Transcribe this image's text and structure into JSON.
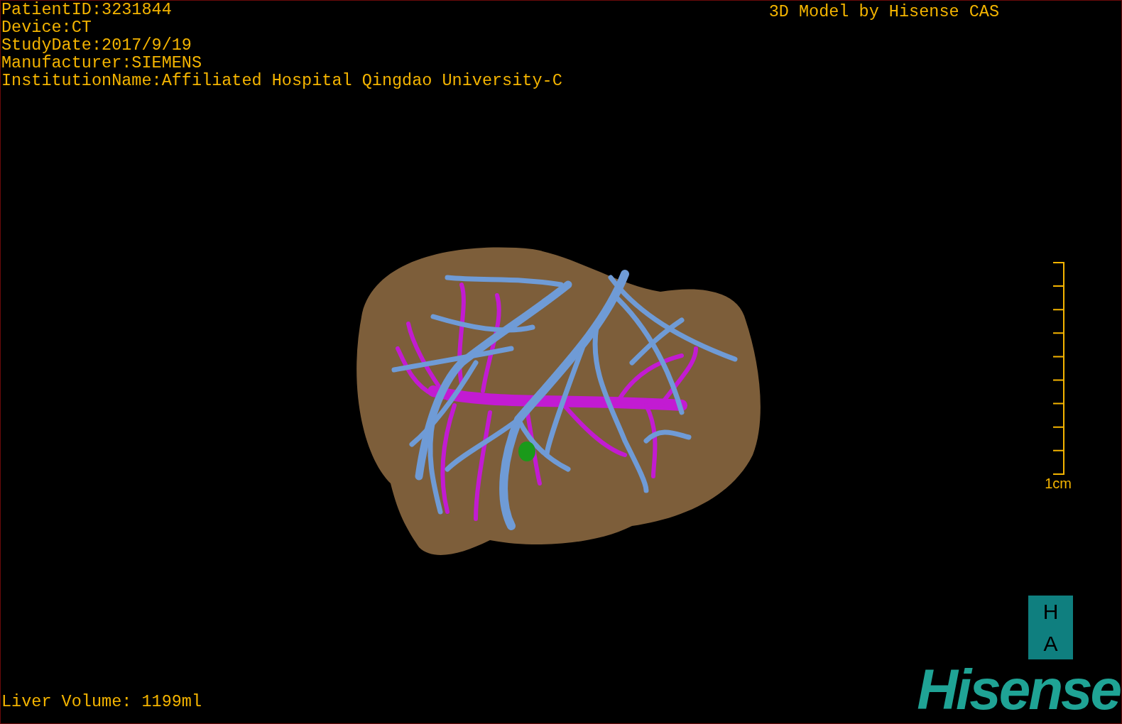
{
  "info_lines": [
    "PatientID:3231844",
    "Device:CT",
    "StudyDate:2017/9/19",
    "Manufacturer:SIEMENS",
    "InstitutionName:Affiliated Hospital Qingdao University-C"
  ],
  "title": "3D Model by Hisense CAS",
  "scale_bar": {
    "label": "1cm"
  },
  "liver_volume": "Liver Volume: 1199ml",
  "logo": {
    "badge_letters": [
      "H",
      "A"
    ],
    "wordmark": "Hisense"
  }
}
